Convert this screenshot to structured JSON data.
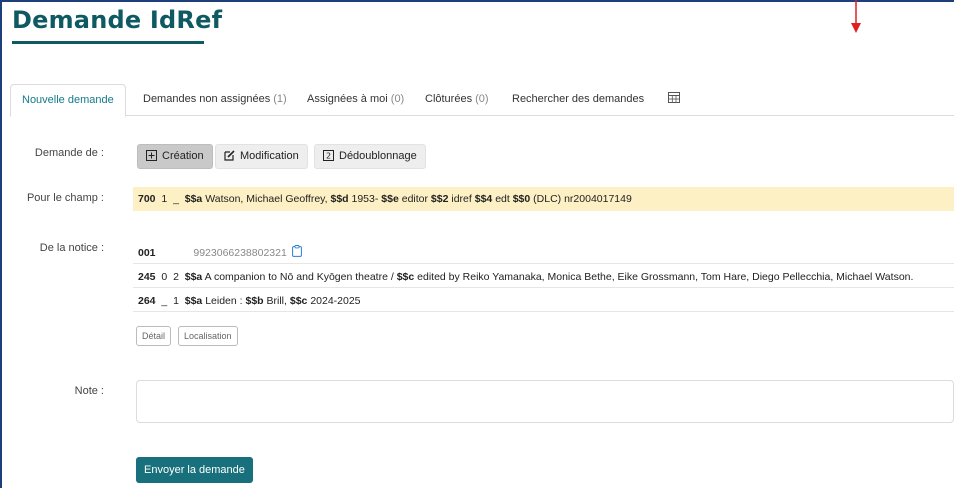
{
  "page": {
    "title": "Demande IdRef"
  },
  "colors": {
    "brand": "#0f5a62",
    "accent": "#147b8a",
    "highlight": "#fdf0c4",
    "submit_bg": "#17707b",
    "arrow": "#e02020"
  },
  "tabs": [
    {
      "label": "Nouvelle demande",
      "count": "",
      "active": true
    },
    {
      "label": "Demandes non assignées",
      "count": "(1)",
      "active": false
    },
    {
      "label": "Assignées à moi",
      "count": "(0)",
      "active": false
    },
    {
      "label": "Clôturées",
      "count": "(0)",
      "active": false
    },
    {
      "label": "Rechercher des demandes",
      "count": "",
      "active": false
    }
  ],
  "tab_icon": "table-grid-icon",
  "demande": {
    "label": "Demande de :",
    "options": [
      {
        "label": "Création",
        "icon": "plus-square-icon",
        "active": true
      },
      {
        "label": "Modification",
        "icon": "edit-pencil-icon",
        "active": false
      },
      {
        "label": "Dédoublonnage",
        "icon": "number-two-square-icon",
        "active": false
      }
    ]
  },
  "champ": {
    "label": "Pour le champ :",
    "tag": "700",
    "ind1": "1",
    "ind2": "_",
    "sa_code": "$$a",
    "sa_text": "Watson, Michael Geoffrey,",
    "sd_code": "$$d",
    "sd_text": "1953-",
    "se_code": "$$e",
    "se_text": "editor",
    "s2_code": "$$2",
    "s2_text": "idref",
    "s4_code": "$$4",
    "s4_text": "edt",
    "s0_code": "$$0",
    "s0_text": "(DLC) nr2004017149"
  },
  "notice": {
    "label": "De la notice :",
    "line001": {
      "tag": "001",
      "value": "9923066238802321",
      "icon": "clipboard-copy-icon"
    },
    "line245": {
      "tag": "245",
      "ind1": "0",
      "ind2": "2",
      "sa_code": "$$a",
      "sa_text": "A companion to Nō and Kyōgen theatre /",
      "sc_code": "$$c",
      "sc_text": "edited by Reiko Yamanaka, Monica Bethe, Eike Grossmann, Tom Hare, Diego Pellecchia, Michael Watson."
    },
    "line264": {
      "tag": "264",
      "ind1": "_",
      "ind2": "1",
      "sa_code": "$$a",
      "sa_text": "Leiden :",
      "sb_code": "$$b",
      "sb_text": "Brill,",
      "sc_code": "$$c",
      "sc_text": "2024-2025"
    },
    "detail_button": "Détail",
    "localisation_button": "Localisation"
  },
  "note": {
    "label": "Note :",
    "value": "",
    "placeholder": ""
  },
  "submit_button": "Envoyer la demande"
}
